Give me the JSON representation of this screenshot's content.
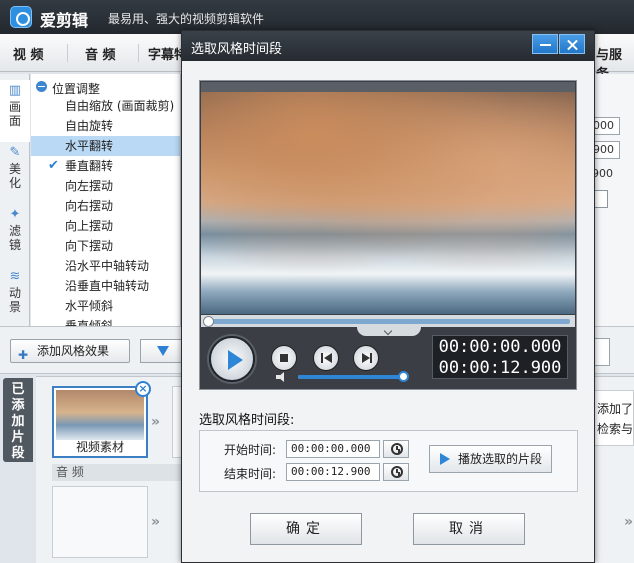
{
  "app": {
    "name": "爱剪辑",
    "slogan": "最易用、强大的视频剪辑软件"
  },
  "menu": [
    {
      "label": "视  频"
    },
    {
      "label": "音  频"
    },
    {
      "label": "字幕特"
    },
    {
      "label": "与服务"
    }
  ],
  "side_tabs": [
    {
      "label": "画面",
      "icon": "screen-icon"
    },
    {
      "label": "美化",
      "icon": "wand-icon"
    },
    {
      "label": "滤镜",
      "icon": "sparkle-icon"
    },
    {
      "label": "动景",
      "icon": "wave-icon"
    }
  ],
  "effect_list": {
    "group": "位置调整",
    "items": [
      {
        "label": "自由缩放 (画面裁剪)",
        "selected": false,
        "checked": false
      },
      {
        "label": "自由旋转",
        "selected": false,
        "checked": false
      },
      {
        "label": "水平翻转",
        "selected": true,
        "checked": false
      },
      {
        "label": "垂直翻转",
        "selected": false,
        "checked": true
      },
      {
        "label": "向左摆动",
        "selected": false,
        "checked": false
      },
      {
        "label": "向右摆动",
        "selected": false,
        "checked": false
      },
      {
        "label": "向上摆动",
        "selected": false,
        "checked": false
      },
      {
        "label": "向下摆动",
        "selected": false,
        "checked": false
      },
      {
        "label": "沿水平中轴转动",
        "selected": false,
        "checked": false
      },
      {
        "label": "沿垂直中轴转动",
        "selected": false,
        "checked": false
      },
      {
        "label": "水平倾斜",
        "selected": false,
        "checked": false
      },
      {
        "label": "垂直倾斜",
        "selected": false,
        "checked": false
      }
    ]
  },
  "background_fields": [
    "000",
    "900",
    "900"
  ],
  "toolbar": {
    "add_effect_label": "添加风格效果"
  },
  "clips": {
    "tab_label": "已添加片段",
    "clip_label": "视频素材",
    "audio_label": "音 频",
    "right_panel_lines": [
      "添加了画",
      "检索与完"
    ]
  },
  "dialog": {
    "title": "选取风格时间段",
    "player": {
      "current_time": "00:00:00.000",
      "total_time": "00:00:12.900",
      "volume_level": 1.0,
      "progress": 0.0
    },
    "section_label": "选取风格时间段:",
    "start_label": "开始时间:",
    "start_value": "00:00:00.000",
    "end_label": "结束时间:",
    "end_value": "00:00:12.900",
    "play_selection_label": "播放选取的片段",
    "ok_label": "确定",
    "cancel_label": "取消"
  },
  "colors": {
    "accent": "#2f86d6",
    "selection": "#b9d9f5",
    "titlebar": "#262b31"
  }
}
